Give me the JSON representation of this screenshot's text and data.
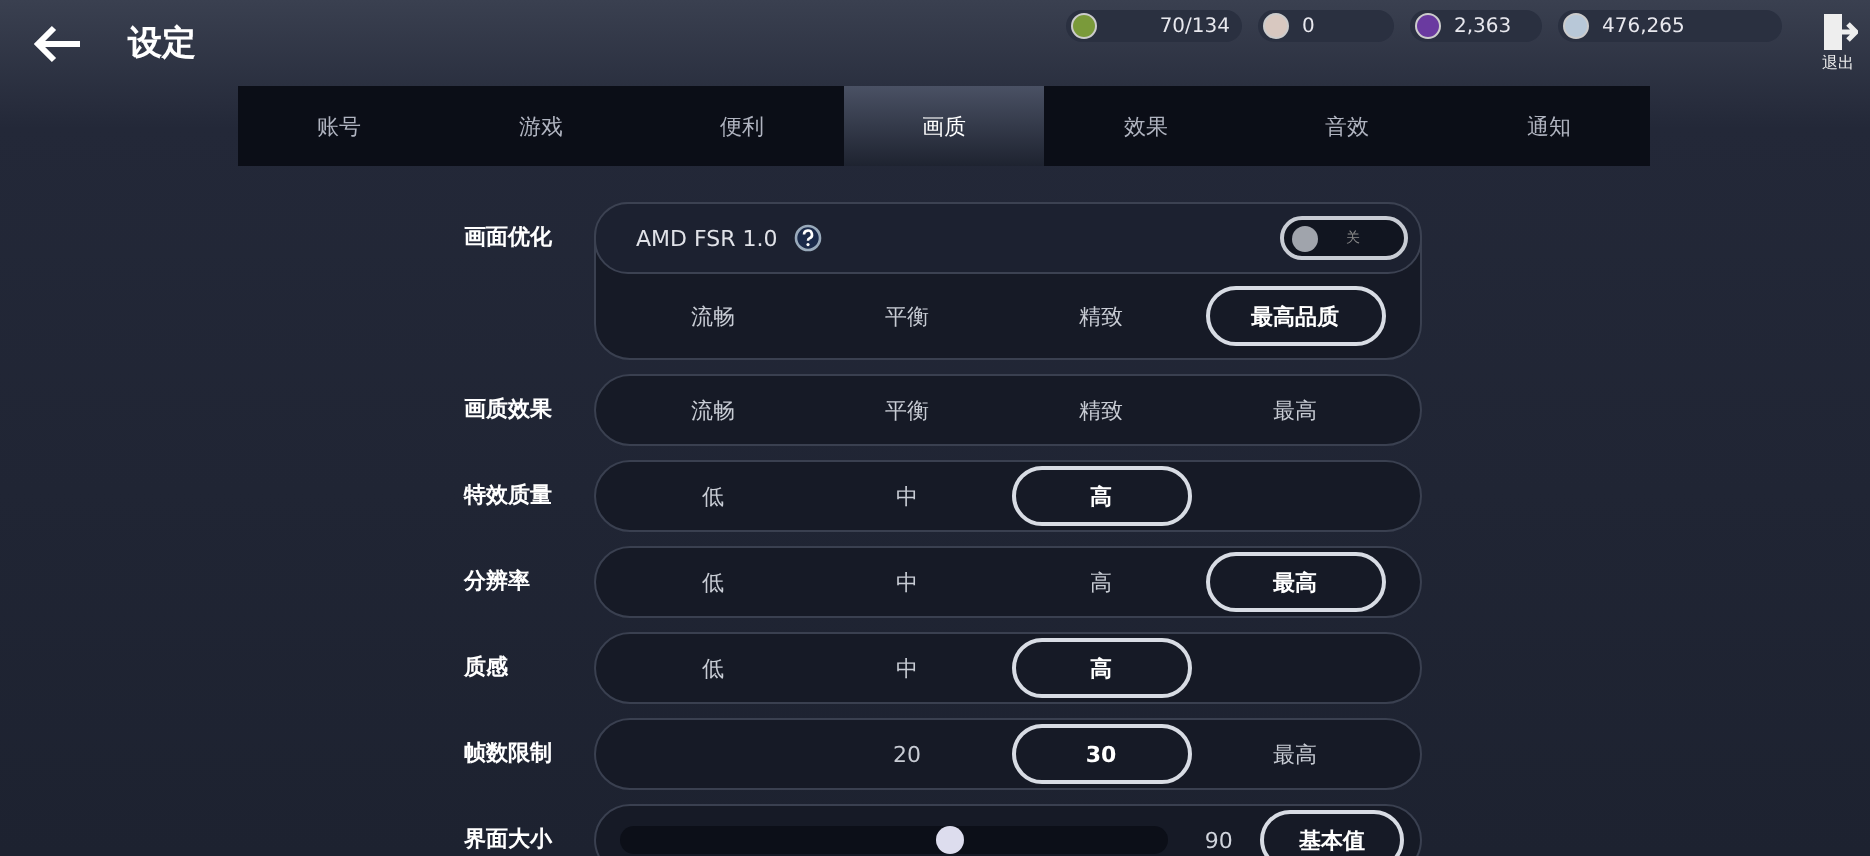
{
  "header": {
    "title": "设定",
    "resources": [
      {
        "kind": "energy",
        "value": "70/134"
      },
      {
        "kind": "pearl",
        "value": "0"
      },
      {
        "kind": "orb",
        "value": "2,363"
      },
      {
        "kind": "coin",
        "value": "476,265"
      }
    ],
    "exit_label": "退出"
  },
  "tabs": [
    {
      "label": "账号",
      "selected": false
    },
    {
      "label": "游戏",
      "selected": false
    },
    {
      "label": "便利",
      "selected": false
    },
    {
      "label": "画质",
      "selected": true
    },
    {
      "label": "效果",
      "selected": false
    },
    {
      "label": "音效",
      "selected": false
    },
    {
      "label": "通知",
      "selected": false
    }
  ],
  "settings": [
    {
      "kind": "preset",
      "label": "画面优化",
      "feature": "AMD FSR 1.0",
      "toggle": {
        "on": false,
        "text": "关"
      },
      "options": [
        {
          "label": "流畅",
          "selected": false
        },
        {
          "label": "平衡",
          "selected": false
        },
        {
          "label": "精致",
          "selected": false
        },
        {
          "label": "最高品质",
          "selected": true
        }
      ]
    },
    {
      "kind": "options",
      "label": "画质效果",
      "leading_blank": false,
      "options": [
        {
          "label": "流畅",
          "selected": false
        },
        {
          "label": "平衡",
          "selected": false
        },
        {
          "label": "精致",
          "selected": false
        },
        {
          "label": "最高",
          "selected": false
        }
      ]
    },
    {
      "kind": "options",
      "label": "特效质量",
      "leading_blank": false,
      "options": [
        {
          "label": "低",
          "selected": false
        },
        {
          "label": "中",
          "selected": false
        },
        {
          "label": "高",
          "selected": true
        }
      ]
    },
    {
      "kind": "options",
      "label": "分辨率",
      "leading_blank": false,
      "options": [
        {
          "label": "低",
          "selected": false
        },
        {
          "label": "中",
          "selected": false
        },
        {
          "label": "高",
          "selected": false
        },
        {
          "label": "最高",
          "selected": true
        }
      ]
    },
    {
      "kind": "options",
      "label": "质感",
      "leading_blank": false,
      "options": [
        {
          "label": "低",
          "selected": false
        },
        {
          "label": "中",
          "selected": false
        },
        {
          "label": "高",
          "selected": true
        }
      ]
    },
    {
      "kind": "options",
      "label": "帧数限制",
      "leading_blank": true,
      "options": [
        {
          "label": "20",
          "selected": false
        },
        {
          "label": "30",
          "selected": true
        },
        {
          "label": "最高",
          "selected": false
        }
      ]
    },
    {
      "kind": "slider",
      "label": "界面大小",
      "level": 0.6,
      "reading": "90",
      "button": "基本值"
    }
  ]
}
